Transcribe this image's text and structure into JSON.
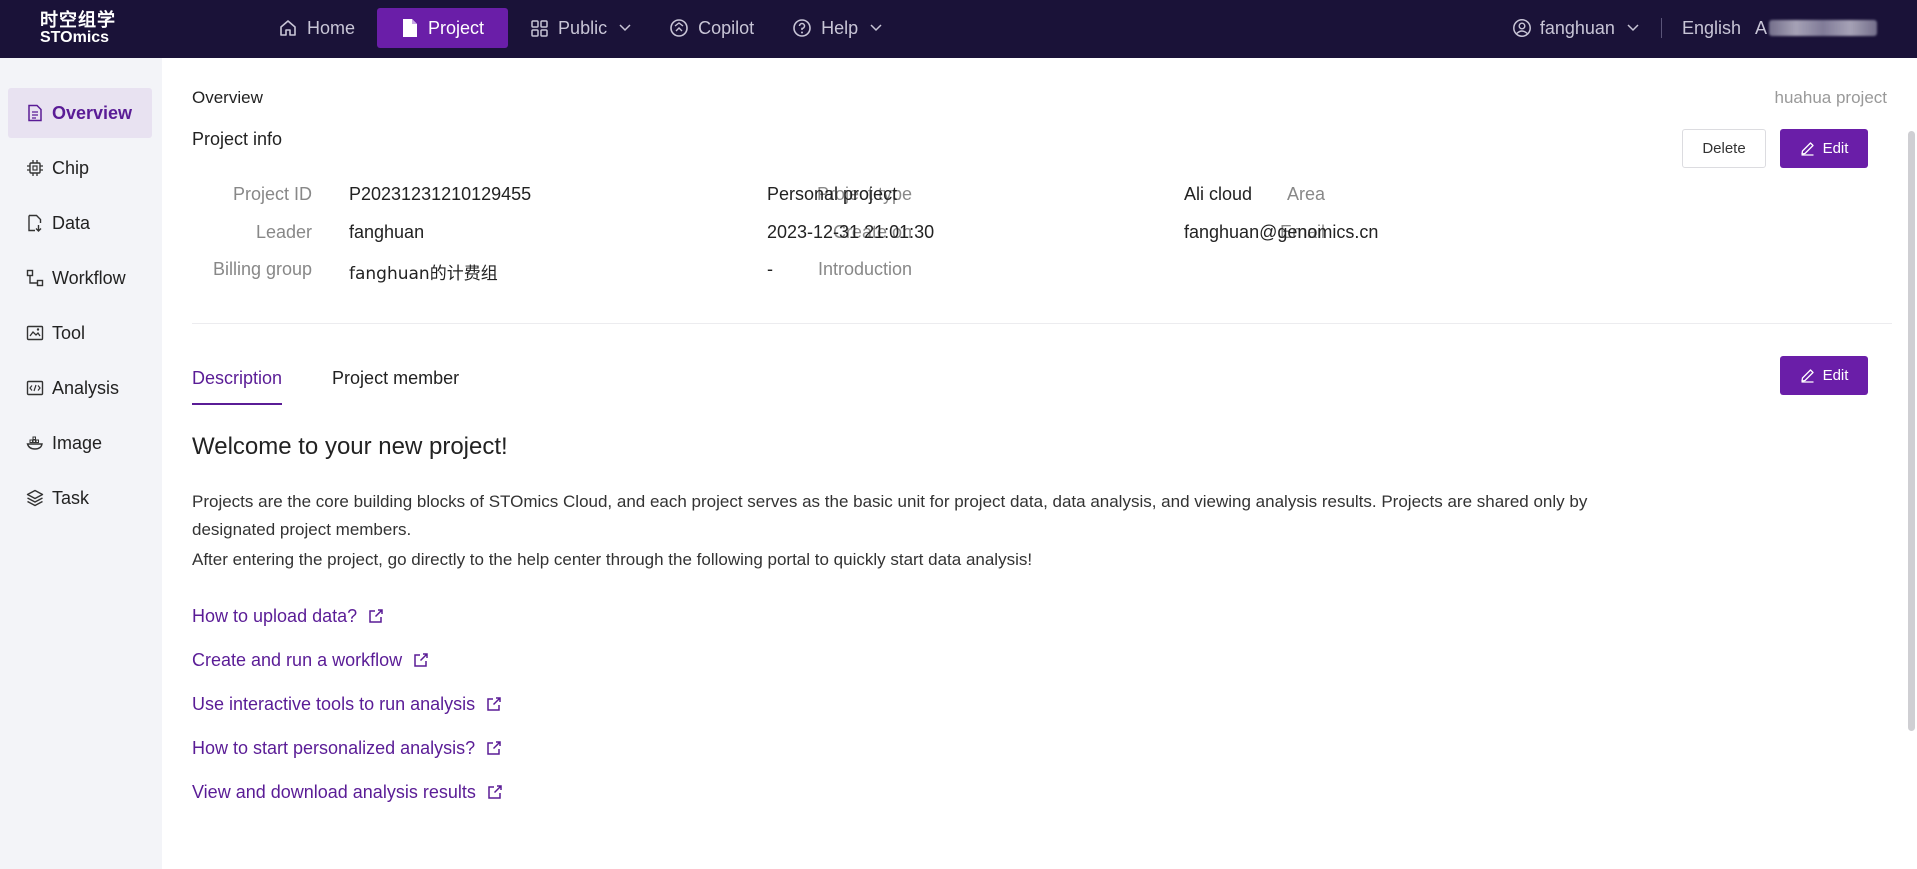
{
  "brand": {
    "cn": "时空组学",
    "en": "STOmics"
  },
  "nav": {
    "items": [
      {
        "label": "Home",
        "icon": "home-icon"
      },
      {
        "label": "Project",
        "icon": "document-icon",
        "active": true
      },
      {
        "label": "Public",
        "icon": "grid-icon",
        "dropdown": true
      },
      {
        "label": "Copilot",
        "icon": "copilot-icon"
      },
      {
        "label": "Help",
        "icon": "help-icon",
        "dropdown": true
      }
    ],
    "user": "fanghuan",
    "language": "English",
    "org_prefix": "A"
  },
  "sidebar": {
    "items": [
      {
        "label": "Overview",
        "icon": "overview-icon",
        "active": true
      },
      {
        "label": "Chip",
        "icon": "chip-icon"
      },
      {
        "label": "Data",
        "icon": "data-icon"
      },
      {
        "label": "Workflow",
        "icon": "workflow-icon"
      },
      {
        "label": "Tool",
        "icon": "tool-icon"
      },
      {
        "label": "Analysis",
        "icon": "analysis-icon"
      },
      {
        "label": "Image",
        "icon": "image-icon"
      },
      {
        "label": "Task",
        "icon": "task-icon"
      }
    ]
  },
  "main": {
    "breadcrumb": "Overview",
    "project_name": "huahua project",
    "section_title": "Project info",
    "delete_label": "Delete",
    "edit_label": "Edit",
    "info": {
      "project_id_label": "Project ID",
      "project_id": "P20231231210129455",
      "project_type_label": "Project type",
      "project_type": "Personal project",
      "area_label": "Area",
      "area": "Ali cloud",
      "leader_label": "Leader",
      "leader": "fanghuan",
      "create_on_label": "Create on",
      "create_on": "2023-12-31 21:01:30",
      "email_label": "Email",
      "email": "fanghuan@genomics.cn",
      "billing_group_label": "Billing group",
      "billing_group": "fanghuan的计费组",
      "introduction_label": "Introduction",
      "introduction": "-"
    },
    "tabs": [
      "Description",
      "Project member"
    ],
    "welcome": "Welcome to your new project!",
    "paragraph1": "Projects are the core building blocks of STOmics Cloud, and each project serves as the basic unit for project data, data analysis, and viewing analysis results. Projects are shared only by designated project members.",
    "paragraph2": "After entering the project, go directly to the help center through the following portal to quickly start data analysis!",
    "links": [
      "How to upload data?",
      "Create and run a workflow",
      "Use interactive tools to run analysis",
      "How to start personalized analysis?",
      "View and download analysis results"
    ]
  },
  "colors": {
    "topbar": "#1a1238",
    "accent": "#6a1ea8",
    "link": "#5a1c96"
  }
}
